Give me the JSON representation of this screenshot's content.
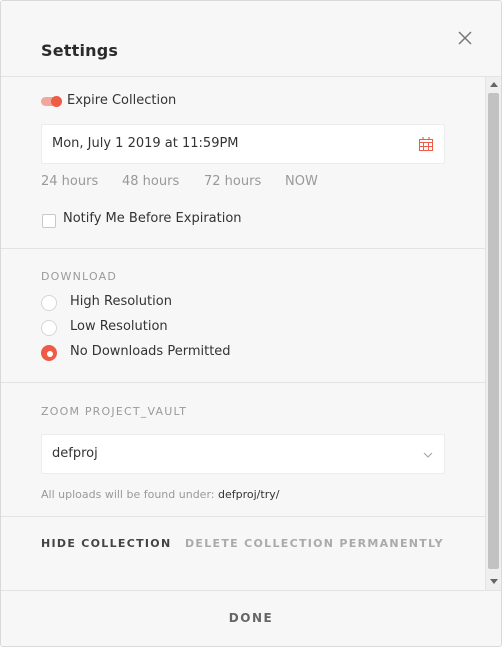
{
  "header": {
    "title": "Settings"
  },
  "expire": {
    "toggle_label": "Expire Collection",
    "date_value": "Mon, July 1 2019 at 11:59PM",
    "quick_options": [
      "24 hours",
      "48 hours",
      "72 hours",
      "NOW"
    ],
    "notify_label": "Notify Me Before Expiration"
  },
  "download": {
    "label": "DOWNLOAD",
    "options": [
      "High Resolution",
      "Low Resolution",
      "No Downloads Permitted"
    ],
    "selected": "No Downloads Permitted"
  },
  "vault": {
    "label": "ZOOM PROJECT_VAULT",
    "selected": "defproj",
    "note_prefix": "All uploads will be found under:",
    "note_path": "defproj/try/"
  },
  "actions": {
    "hide": "HIDE COLLECTION",
    "delete": "DELETE COLLECTION PERMANENTLY"
  },
  "footer": {
    "done": "DONE"
  },
  "colors": {
    "accent": "#ee5b46",
    "accent_light": "#f2a79c",
    "muted_text": "#999999"
  }
}
